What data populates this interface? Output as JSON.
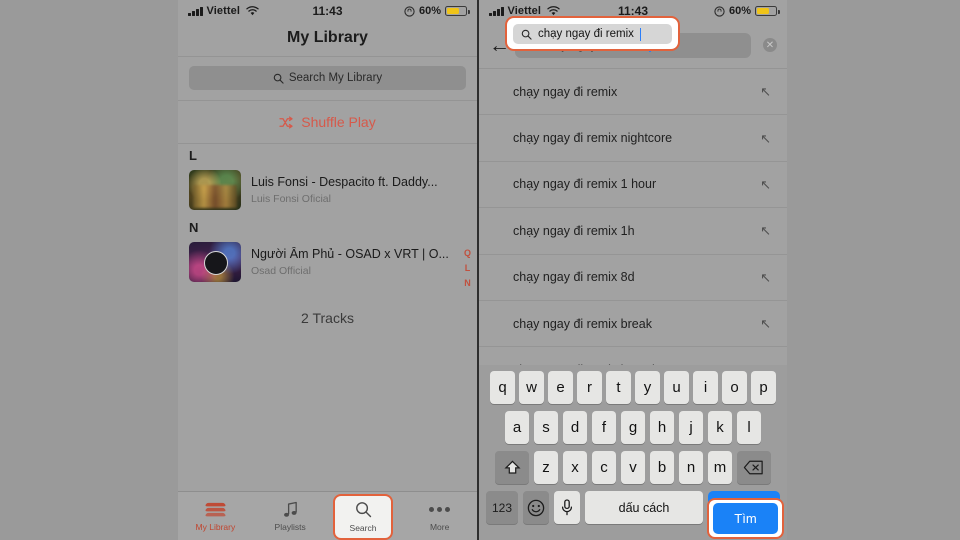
{
  "status_bar": {
    "carrier": "Viettel",
    "time": "11:43",
    "battery_text": "60%",
    "wifi_icon": "wifi-icon",
    "signal_icon": "signal-bars-icon",
    "battery_icon": "battery-icon",
    "lock_icon": "rotation-lock-icon"
  },
  "left_screen": {
    "nav_title": "My Library",
    "search_placeholder": "Search My Library",
    "search_icon": "search-icon",
    "shuffle_label": "Shuffle Play",
    "shuffle_icon": "shuffle-icon",
    "sections": [
      {
        "letter": "L",
        "tracks": [
          {
            "title": "Luis Fonsi - Despacito ft. Daddy...",
            "artist": "Luis Fonsi Oficial"
          }
        ]
      },
      {
        "letter": "N",
        "tracks": [
          {
            "title": "Người Âm Phủ - OSAD x VRT | O...",
            "artist": "Osad Official"
          }
        ]
      }
    ],
    "index_rail": [
      "Q",
      "L",
      "N"
    ],
    "track_count": "2 Tracks",
    "tabs": [
      {
        "label": "My Library",
        "icon": "layers-icon",
        "active": true
      },
      {
        "label": "Playlists",
        "icon": "music-note-icon",
        "active": false
      },
      {
        "label": "Search",
        "icon": "search-icon",
        "active": false
      },
      {
        "label": "More",
        "icon": "ellipsis-icon",
        "active": false
      }
    ]
  },
  "right_screen": {
    "back_icon": "back-arrow-icon",
    "search_icon": "search-icon",
    "search_value": "chạy ngay đi remix",
    "clear_icon": "clear-circle-icon",
    "suggestions": [
      {
        "text": "chạy ngay đi remix",
        "icon": "arrow-up-left-icon"
      },
      {
        "text": "chạy ngay đi remix nightcore",
        "icon": "arrow-up-left-icon"
      },
      {
        "text": "chạy ngay đi remix 1 hour",
        "icon": "arrow-up-left-icon"
      },
      {
        "text": "chạy ngay đi remix 1h",
        "icon": "arrow-up-left-icon"
      },
      {
        "text": "chạy ngay đi remix 8d",
        "icon": "arrow-up-left-icon"
      },
      {
        "text": "chạy ngay đi remix break",
        "icon": "arrow-up-left-icon"
      },
      {
        "text": "chạy ngay đi remix karaoke",
        "icon": "arrow-up-left-icon"
      }
    ],
    "keyboard": {
      "row1": [
        "q",
        "w",
        "e",
        "r",
        "t",
        "y",
        "u",
        "i",
        "o",
        "p"
      ],
      "row2": [
        "a",
        "s",
        "d",
        "f",
        "g",
        "h",
        "j",
        "k",
        "l"
      ],
      "row3": [
        "z",
        "x",
        "c",
        "v",
        "b",
        "n",
        "m"
      ],
      "shift_icon": "shift-icon",
      "backspace_icon": "backspace-icon",
      "numbers_label": "123",
      "emoji_icon": "emoji-icon",
      "mic_icon": "microphone-icon",
      "space_label": "dấu cách",
      "go_label": "Tìm"
    }
  },
  "annotations": {
    "border_color": "#e2623c",
    "search_tab_highlight": "Search tab highlighted",
    "search_field_highlight": "Search field highlighted",
    "go_key_highlight": "Tìm key highlighted"
  }
}
